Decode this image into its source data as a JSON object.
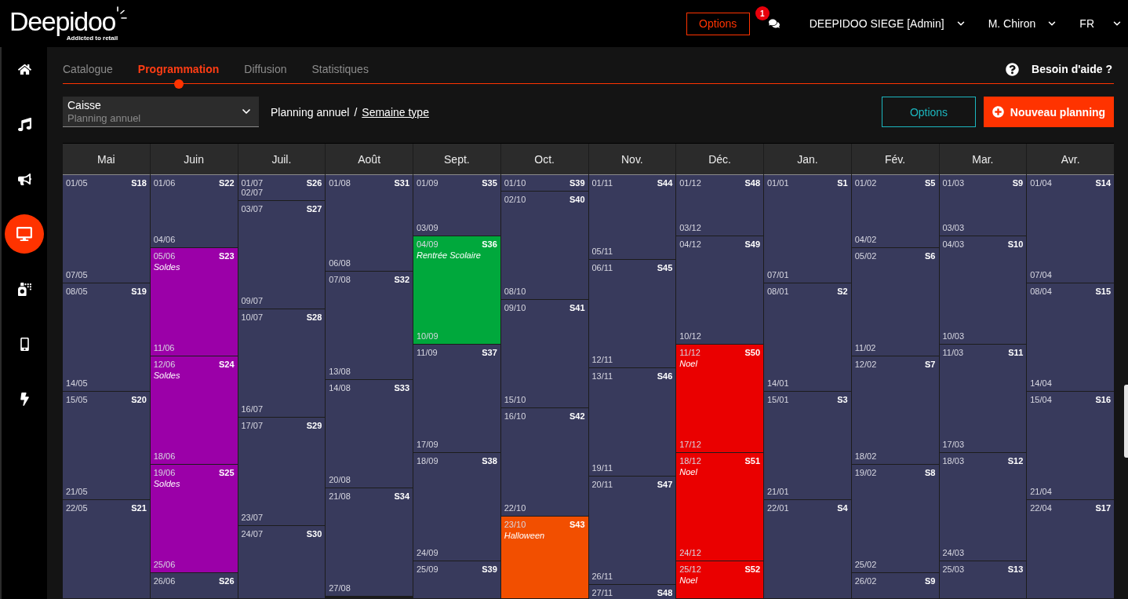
{
  "topbar": {
    "logo": "Deepidoo",
    "tagline": "Addicted to retail",
    "options_button": "Options",
    "notifications": {
      "count": "1"
    },
    "menus": [
      {
        "label": "DEEPIDOO SIEGE [Admin]"
      },
      {
        "label": "M. Chiron"
      },
      {
        "label": "FR"
      }
    ]
  },
  "sidebar": {
    "items": [
      {
        "selected": false
      },
      {
        "selected": false
      },
      {
        "selected": false
      },
      {
        "selected": true
      },
      {
        "selected": false
      },
      {
        "selected": false
      },
      {
        "selected": false
      }
    ]
  },
  "tabs": [
    {
      "label": "Catalogue",
      "selected": false
    },
    {
      "label": "Programmation",
      "selected": true
    },
    {
      "label": "Diffusion",
      "selected": false
    },
    {
      "label": "Statistiques",
      "selected": false
    }
  ],
  "help": {
    "label": "Besoin d'aide ?"
  },
  "toolbar": {
    "select": {
      "value": "Caisse",
      "subtitle": "Planning annuel"
    },
    "breadcrumb": {
      "items": [
        {
          "label": "Planning annuel",
          "kind": "current"
        },
        {
          "label": "Semaine type",
          "kind": "link"
        }
      ],
      "separator": "/"
    },
    "options_button": "Options",
    "new_button": "Nouveau planning"
  },
  "calendar": {
    "months": [
      {
        "name": "Mai",
        "weeks": [
          {
            "start": "01/05",
            "end": "07/05",
            "week": "S18"
          },
          {
            "start": "08/05",
            "end": "14/05",
            "week": "S19"
          },
          {
            "start": "15/05",
            "end": "21/05",
            "week": "S20"
          },
          {
            "start": "22/05",
            "week": "S21"
          }
        ]
      },
      {
        "name": "Juin",
        "weeks": [
          {
            "start": "01/06",
            "end": "04/06",
            "week": "S22"
          },
          {
            "start": "05/06",
            "end": "11/06",
            "week": "S23",
            "event": "Soldes",
            "color": "#9b00a8"
          },
          {
            "start": "12/06",
            "end": "18/06",
            "week": "S24",
            "event": "Soldes",
            "color": "#9b00a8"
          },
          {
            "start": "19/06",
            "end": "25/06",
            "week": "S25",
            "event": "Soldes",
            "color": "#9b00a8"
          },
          {
            "start": "26/06",
            "week": "S26"
          }
        ]
      },
      {
        "name": "Juil.",
        "weeks": [
          {
            "start": "01/07",
            "end": "02/07",
            "week": "S26"
          },
          {
            "start": "03/07",
            "end": "09/07",
            "week": "S27"
          },
          {
            "start": "10/07",
            "end": "16/07",
            "week": "S28"
          },
          {
            "start": "17/07",
            "end": "23/07",
            "week": "S29"
          },
          {
            "start": "24/07",
            "week": "S30"
          }
        ]
      },
      {
        "name": "Août",
        "weeks": [
          {
            "start": "01/08",
            "end": "06/08",
            "week": "S31"
          },
          {
            "start": "07/08",
            "end": "13/08",
            "week": "S32"
          },
          {
            "start": "14/08",
            "end": "20/08",
            "week": "S33"
          },
          {
            "start": "21/08",
            "end": "27/08",
            "week": "S34"
          }
        ]
      },
      {
        "name": "Sept.",
        "weeks": [
          {
            "start": "01/09",
            "end": "03/09",
            "week": "S35"
          },
          {
            "start": "04/09",
            "end": "10/09",
            "week": "S36",
            "event": "Rentrée Scolaire",
            "color": "#00a83c"
          },
          {
            "start": "11/09",
            "end": "17/09",
            "week": "S37"
          },
          {
            "start": "18/09",
            "end": "24/09",
            "week": "S38"
          },
          {
            "start": "25/09",
            "week": "S39"
          }
        ]
      },
      {
        "name": "Oct.",
        "weeks": [
          {
            "start": "01/10",
            "week": "S39"
          },
          {
            "start": "02/10",
            "end": "08/10",
            "week": "S40"
          },
          {
            "start": "09/10",
            "end": "15/10",
            "week": "S41"
          },
          {
            "start": "16/10",
            "end": "22/10",
            "week": "S42"
          },
          {
            "start": "23/10",
            "week": "S43",
            "event": "Halloween",
            "color": "#f24f00"
          }
        ]
      },
      {
        "name": "Nov.",
        "weeks": [
          {
            "start": "01/11",
            "end": "05/11",
            "week": "S44"
          },
          {
            "start": "06/11",
            "end": "12/11",
            "week": "S45"
          },
          {
            "start": "13/11",
            "end": "19/11",
            "week": "S46"
          },
          {
            "start": "20/11",
            "end": "26/11",
            "week": "S47"
          },
          {
            "start": "27/11",
            "week": "S48"
          }
        ]
      },
      {
        "name": "Déc.",
        "weeks": [
          {
            "start": "01/12",
            "end": "03/12",
            "week": "S48"
          },
          {
            "start": "04/12",
            "end": "10/12",
            "week": "S49"
          },
          {
            "start": "11/12",
            "end": "17/12",
            "week": "S50",
            "event": "Noel",
            "color": "#ea0000"
          },
          {
            "start": "18/12",
            "end": "24/12",
            "week": "S51",
            "event": "Noel",
            "color": "#ea0000"
          },
          {
            "start": "25/12",
            "week": "S52",
            "event": "Noel",
            "color": "#ea0000"
          }
        ]
      },
      {
        "name": "Jan.",
        "weeks": [
          {
            "start": "01/01",
            "end": "07/01",
            "week": "S1"
          },
          {
            "start": "08/01",
            "end": "14/01",
            "week": "S2"
          },
          {
            "start": "15/01",
            "end": "21/01",
            "week": "S3"
          },
          {
            "start": "22/01",
            "week": "S4"
          }
        ]
      },
      {
        "name": "Fév.",
        "weeks": [
          {
            "start": "01/02",
            "end": "04/02",
            "week": "S5"
          },
          {
            "start": "05/02",
            "end": "11/02",
            "week": "S6"
          },
          {
            "start": "12/02",
            "end": "18/02",
            "week": "S7"
          },
          {
            "start": "19/02",
            "end": "25/02",
            "week": "S8"
          },
          {
            "start": "26/02",
            "week": "S9"
          }
        ]
      },
      {
        "name": "Mar.",
        "weeks": [
          {
            "start": "01/03",
            "end": "03/03",
            "week": "S9"
          },
          {
            "start": "04/03",
            "end": "10/03",
            "week": "S10"
          },
          {
            "start": "11/03",
            "end": "17/03",
            "week": "S11"
          },
          {
            "start": "18/03",
            "end": "24/03",
            "week": "S12"
          },
          {
            "start": "25/03",
            "week": "S13"
          }
        ]
      },
      {
        "name": "Avr.",
        "weeks": [
          {
            "start": "01/04",
            "end": "07/04",
            "week": "S14"
          },
          {
            "start": "08/04",
            "end": "14/04",
            "week": "S15"
          },
          {
            "start": "15/04",
            "end": "21/04",
            "week": "S16"
          },
          {
            "start": "22/04",
            "week": "S17"
          }
        ]
      }
    ]
  }
}
